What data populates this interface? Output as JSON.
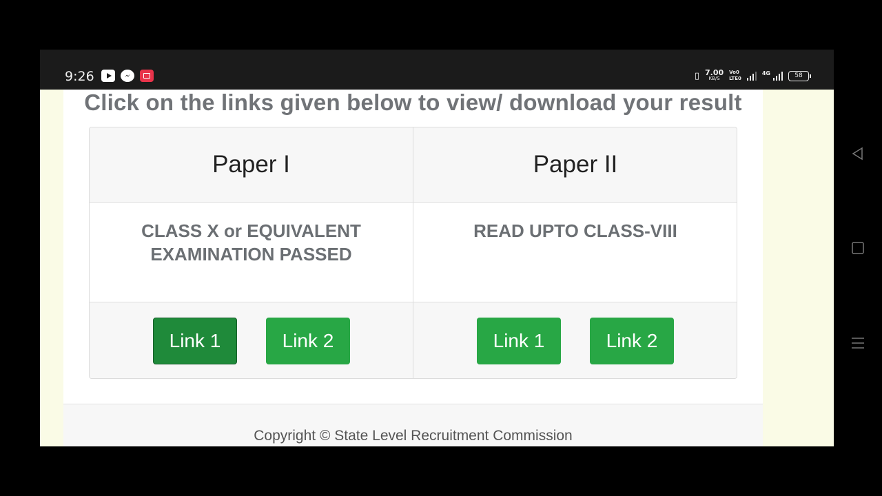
{
  "status_bar": {
    "time": "9:26",
    "notification_icons": [
      "youtube-icon",
      "messenger-icon",
      "screen-recorder-icon"
    ],
    "net_speed_value": "7.00",
    "net_speed_unit": "KB/S",
    "volte_top": "Vo0",
    "volte_bottom": "LTE0",
    "network_type": "4G",
    "battery": "58"
  },
  "page": {
    "heading": "Click on the links given below to view/ download your result",
    "columns": [
      {
        "title": "Paper I",
        "description": "CLASS X or EQUIVALENT EXAMINATION PASSED",
        "links": [
          "Link 1",
          "Link 2"
        ]
      },
      {
        "title": "Paper II",
        "description": "READ UPTO CLASS-VIII",
        "links": [
          "Link 1",
          "Link 2"
        ]
      }
    ],
    "footer": "Copyright © State Level Recruitment Commission"
  },
  "colors": {
    "button_green": "#28a745",
    "button_green_pressed": "#1f8a3a",
    "heading_gray": "#707377",
    "page_background": "#fafbe6"
  },
  "nav_bar": {
    "icons": [
      "back-icon",
      "home-icon",
      "recents-icon"
    ]
  }
}
